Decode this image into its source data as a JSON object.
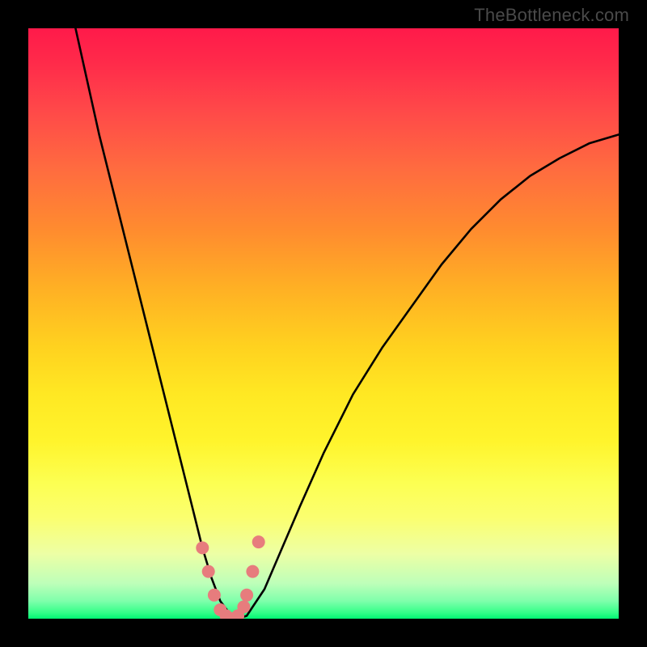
{
  "watermark": "TheBottleneck.com",
  "chart_data": {
    "type": "line",
    "title": "",
    "xlabel": "",
    "ylabel": "",
    "xlim": [
      0,
      100
    ],
    "ylim": [
      0,
      100
    ],
    "series": [
      {
        "name": "bottleneck-curve",
        "x": [
          8,
          10,
          12,
          14,
          16,
          18,
          20,
          22,
          24,
          26,
          28,
          29.5,
          31,
          32.5,
          34,
          35.5,
          37,
          38,
          40,
          43,
          46,
          50,
          55,
          60,
          65,
          70,
          75,
          80,
          85,
          90,
          95,
          100
        ],
        "y": [
          100,
          91,
          82,
          74,
          66,
          58,
          50,
          42,
          34,
          26,
          18,
          12,
          7,
          3,
          1,
          0,
          0.5,
          2,
          5,
          12,
          19,
          28,
          38,
          46,
          53,
          60,
          66,
          71,
          75,
          78,
          80.5,
          82
        ]
      }
    ],
    "highlight_points": {
      "name": "optimal-zone-markers",
      "x": [
        29.5,
        30.5,
        31.5,
        32.5,
        33.5,
        34.5,
        35.5,
        36.5,
        37,
        38,
        39
      ],
      "y": [
        12,
        8,
        4,
        1.5,
        0.5,
        0,
        0.5,
        2,
        4,
        8,
        13
      ]
    },
    "gradient_stops": [
      {
        "pos": 0,
        "color": "#ff1a4a"
      },
      {
        "pos": 50,
        "color": "#ffd21f"
      },
      {
        "pos": 80,
        "color": "#fcff52"
      },
      {
        "pos": 100,
        "color": "#00f773"
      }
    ]
  }
}
